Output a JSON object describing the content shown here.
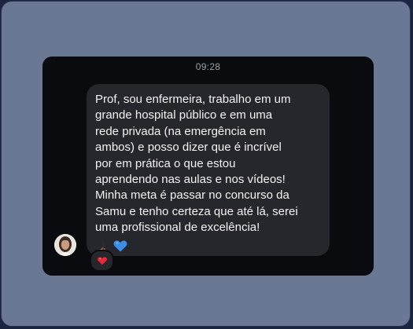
{
  "chat": {
    "timestamp": "09:28",
    "message": {
      "lines": [
        "Prof, sou enfermeira, trabalho em um",
        "grande hospital público e em uma",
        "rede privada (na emergência em",
        "ambos) e posso dizer que é incrível",
        "por em prática o que estou",
        "aprendendo nas aulas e nos vídeos!",
        "Minha meta é passar no concurso da",
        "Samu e tenho certeza que até lá, serei",
        "uma profissional de excelência!"
      ],
      "emojis": [
        "praying-hands-icon",
        "blue-heart-icon"
      ]
    },
    "reaction": "red-heart-icon",
    "colors": {
      "background": "#090b0f",
      "bubble": "#26272c",
      "text": "#f3f3f5",
      "timestamp": "#9aa0a8"
    }
  }
}
